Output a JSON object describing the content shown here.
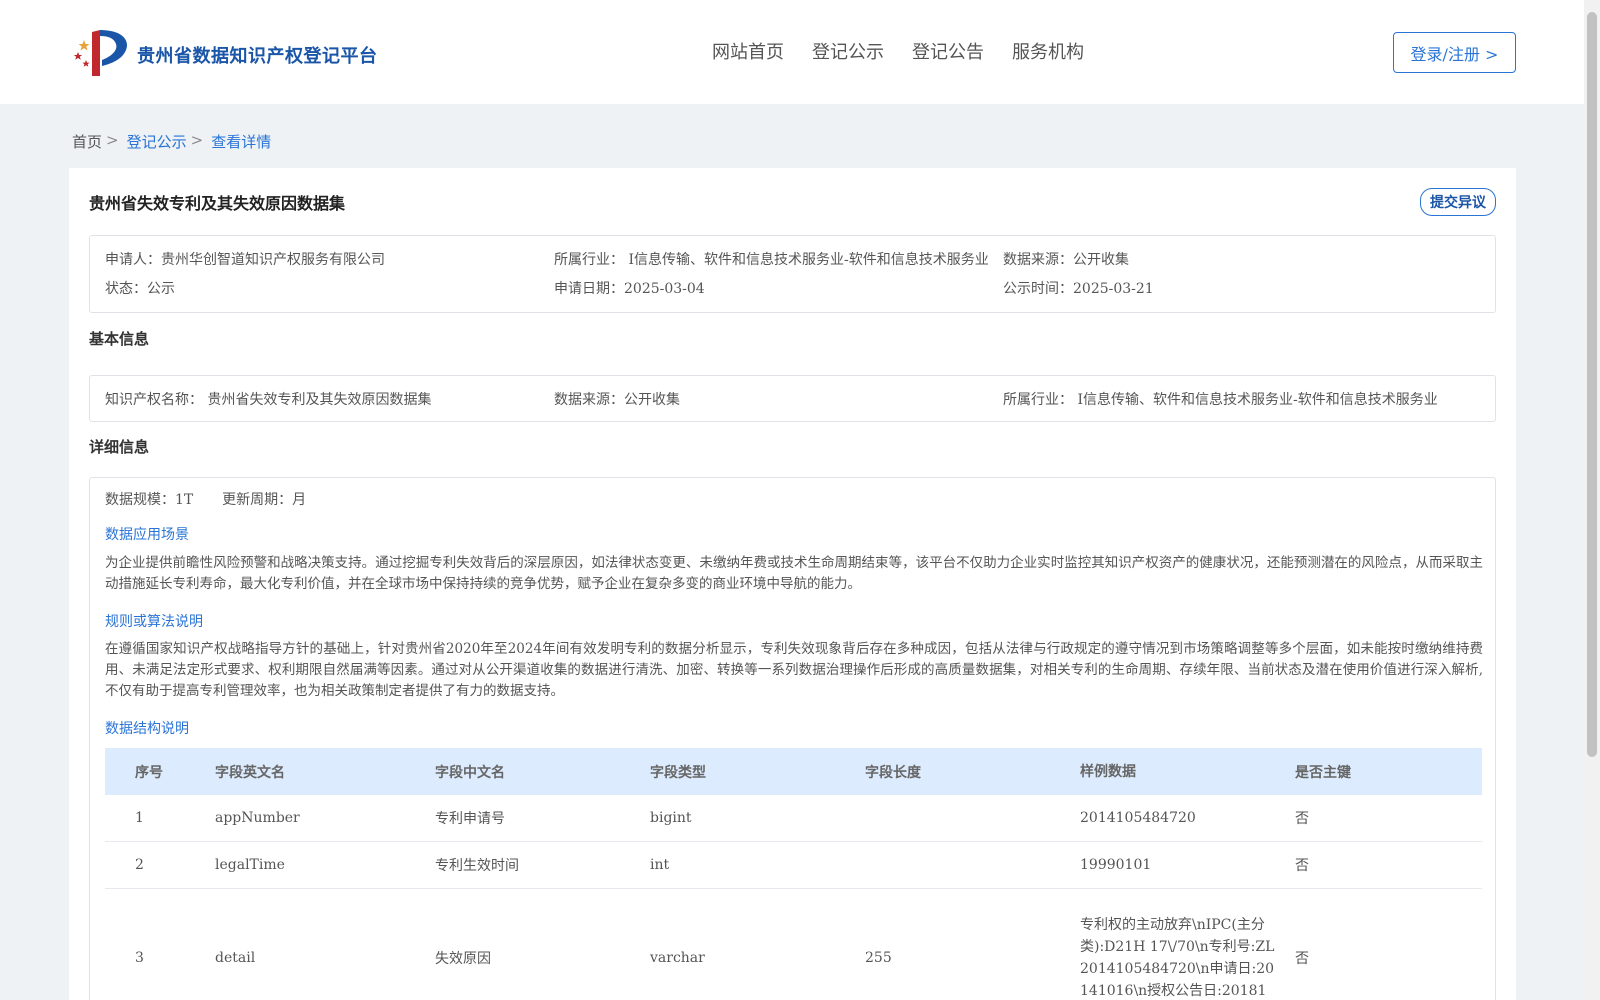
{
  "header": {
    "site_title": "贵州省数据知识产权登记平台",
    "nav": [
      "网站首页",
      "登记公示",
      "登记公告",
      "服务机构"
    ],
    "login_label": "登录/注册 >"
  },
  "breadcrumb": {
    "home": "首页",
    "list": "登记公示",
    "current": "查看详情",
    "sep": ">"
  },
  "dataset": {
    "title": "贵州省失效专利及其失效原因数据集",
    "objection_label": "提交异议",
    "summary": {
      "applicant_label": "申请人：",
      "applicant": "贵州华创智道知识产权服务有限公司",
      "industry_label": "所属行业：",
      "industry": "I信息传输、软件和信息技术服务业-软件和信息技术服务业",
      "source_label": "数据来源：",
      "source": "公开收集",
      "status_label": "状态：",
      "status": "公示",
      "apply_date_label": "申请日期：",
      "apply_date": "2025-03-04",
      "publish_time_label": "公示时间：",
      "publish_time": "2025-03-21"
    },
    "basic": {
      "section_title": "基本信息",
      "ip_name_label": "知识产权名称：",
      "ip_name": "贵州省失效专利及其失效原因数据集",
      "source_label": "数据来源：",
      "source": "公开收集",
      "industry_label": "所属行业：",
      "industry": "I信息传输、软件和信息技术服务业-软件和信息技术服务业"
    },
    "detail": {
      "section_title": "详细信息",
      "scale_label": "数据规模：",
      "scale": "1T",
      "cycle_label": "更新周期：",
      "cycle": "月",
      "scenario_title": "数据应用场景",
      "scenario_text": "为企业提供前瞻性风险预警和战略决策支持。通过挖掘专利失效背后的深层原因，如法律状态变更、未缴纳年费或技术生命周期结束等，该平台不仅助力企业实时监控其知识产权资产的健康状况，还能预测潜在的风险点，从而采取主动措施延长专利寿命，最大化专利价值，并在全球市场中保持持续的竞争优势，赋予企业在复杂多变的商业环境中导航的能力。",
      "rules_title": "规则或算法说明",
      "rules_text": "在遵循国家知识产权战略指导方针的基础上，针对贵州省2020年至2024年间有效发明专利的数据分析显示，专利失效现象背后存在多种成因，包括从法律与行政规定的遵守情况到市场策略调整等多个层面，如未能按时缴纳维持费用、未满足法定形式要求、权利期限自然届满等因素。通过对从公开渠道收集的数据进行清洗、加密、转换等一系列数据治理操作后形成的高质量数据集，对相关专利的生命周期、存续年限、当前状态及潜在使用价值进行深入解析,不仅有助于提高专利管理效率，也为相关政策制定者提供了有力的数据支持。",
      "structure_title": "数据结构说明",
      "table": {
        "headers": [
          "序号",
          "字段英文名",
          "字段中文名",
          "字段类型",
          "字段长度",
          "样例数据",
          "是否主键"
        ],
        "rows": [
          [
            "1",
            "appNumber",
            "专利申请号",
            "bigint",
            "",
            "2014105484720",
            "否"
          ],
          [
            "2",
            "legalTime",
            "专利生效时间",
            "int",
            "",
            "19990101",
            "否"
          ],
          [
            "3",
            "detail",
            "失效原因",
            "varchar",
            "255",
            "专利权的主动放弃\\nIPC(主分类):D21H 17\\/70\\n专利号:ZL2014105484720\\n申请日:20141016\\n授权公告日:20181",
            "否"
          ]
        ]
      }
    }
  }
}
